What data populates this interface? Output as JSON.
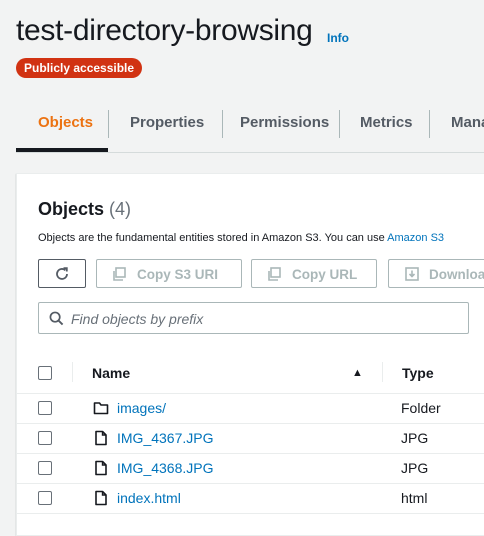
{
  "bucket": {
    "name": "test-directory-browsing",
    "info_label": "Info",
    "access_badge": "Publicly accessible"
  },
  "tabs": [
    {
      "label": "Objects",
      "active": true
    },
    {
      "label": "Properties"
    },
    {
      "label": "Permissions"
    },
    {
      "label": "Metrics"
    },
    {
      "label": "Mana"
    }
  ],
  "objects_panel": {
    "heading": "Objects",
    "count": "(4)",
    "description": "Objects are the fundamental entities stored in Amazon S3. You can use ",
    "description_link": "Amazon S3",
    "buttons": {
      "refresh": "",
      "copy_s3_uri": "Copy S3 URI",
      "copy_url": "Copy URL",
      "download": "Downloa"
    },
    "search": {
      "placeholder": "Find objects by prefix",
      "value": ""
    },
    "columns": {
      "name": "Name",
      "type": "Type",
      "sort": "▲"
    },
    "rows": [
      {
        "name": "images/",
        "type": "Folder",
        "icon": "folder-icon"
      },
      {
        "name": "IMG_4367.JPG",
        "type": "JPG",
        "icon": "file-icon"
      },
      {
        "name": "IMG_4368.JPG",
        "type": "JPG",
        "icon": "file-icon"
      },
      {
        "name": "index.html",
        "type": "html",
        "icon": "file-icon"
      }
    ]
  },
  "colors": {
    "accent": "#ec7211",
    "link": "#0073bb",
    "badge": "#d13212"
  }
}
